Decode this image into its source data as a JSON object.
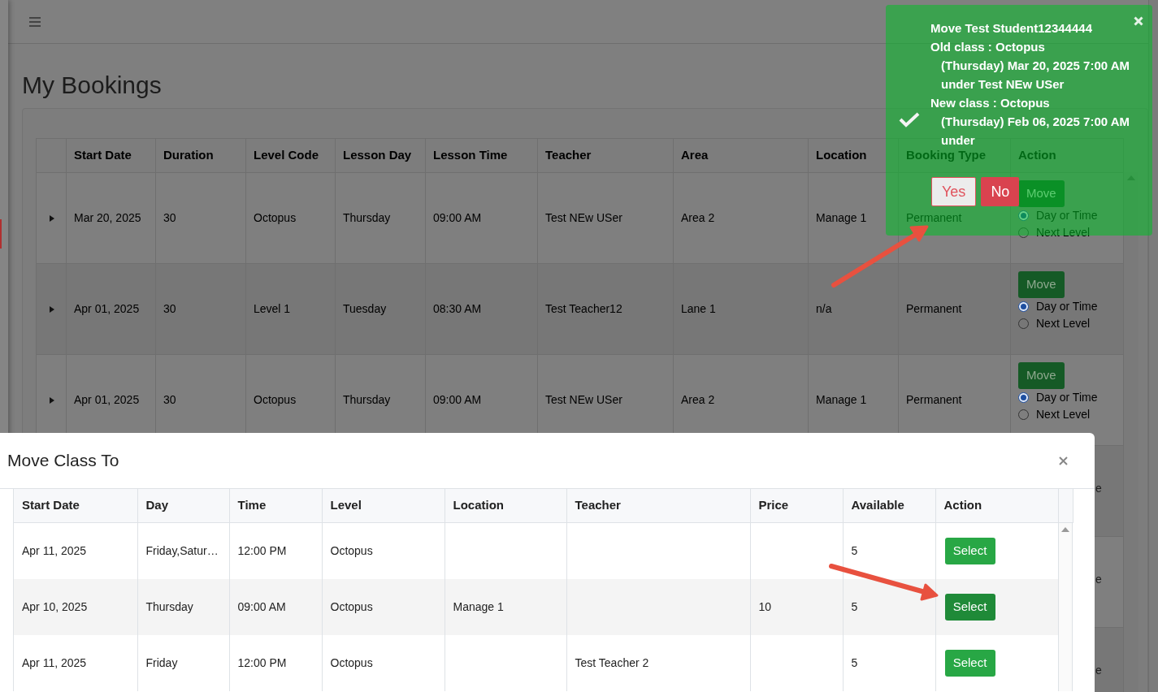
{
  "page_title": "My Bookings",
  "bookings": {
    "columns": [
      "Start Date",
      "Duration",
      "Level Code",
      "Lesson Day",
      "Lesson Time",
      "Teacher",
      "Area",
      "Location",
      "Booking Type",
      "Action"
    ],
    "rows": [
      {
        "cells": [
          "Mar 20, 2025",
          "30",
          "Octopus",
          "Thursday",
          "09:00 AM",
          "Test NEw USer",
          "Area 2",
          "Manage 1",
          "Permanent"
        ],
        "button": "Move",
        "options": [
          {
            "label": "Day or Time",
            "selected": true
          },
          {
            "label": "Next Level",
            "selected": false
          }
        ]
      },
      {
        "cells": [
          "Apr 01, 2025",
          "30",
          "Level 1",
          "Tuesday",
          "08:30 AM",
          "Test Teacher12",
          "Lane 1",
          "n/a",
          "Permanent"
        ],
        "button": "Move",
        "options": [
          {
            "label": "Day or Time",
            "selected": true
          },
          {
            "label": "Next Level",
            "selected": false
          }
        ]
      },
      {
        "cells": [
          "Apr 01, 2025",
          "30",
          "Octopus",
          "Thursday",
          "09:00 AM",
          "Test NEw USer",
          "Area 2",
          "Manage 1",
          "Permanent"
        ],
        "button": "Move",
        "options": [
          {
            "label": "Day or Time",
            "selected": true
          },
          {
            "label": "Next Level",
            "selected": false
          }
        ]
      }
    ],
    "covered_rows": [
      {
        "fragment": "e"
      },
      {
        "fragment": "e"
      },
      {
        "fragment": "e"
      }
    ]
  },
  "toast": {
    "lines": [
      {
        "kind": "heading",
        "text": "Move Test Student12344444"
      },
      {
        "kind": "heading",
        "text": "Old class : Octopus"
      },
      {
        "kind": "detail",
        "text": "(Thursday) Mar 20, 2025 7:00 AM"
      },
      {
        "kind": "detail",
        "text": "under Test NEw USer"
      },
      {
        "kind": "heading",
        "text": "New class : Octopus"
      },
      {
        "kind": "detail",
        "text": "(Thursday) Feb 06, 2025 7:00 AM"
      },
      {
        "kind": "detail",
        "text": "under"
      }
    ],
    "buttons": [
      {
        "kind": "confirm",
        "label": "Yes"
      },
      {
        "kind": "cancel",
        "label": "No"
      }
    ]
  },
  "modal": {
    "title": "Move Class To",
    "columns": [
      "Start Date",
      "Day",
      "Time",
      "Level",
      "Location",
      "Teacher",
      "Price",
      "Available",
      "Action"
    ],
    "rows": [
      {
        "cells": [
          "Apr 11, 2025",
          "Friday,Satur…",
          "12:00 PM",
          "Octopus",
          "",
          "",
          "",
          "5"
        ],
        "button": "Select",
        "highlighted": false
      },
      {
        "cells": [
          "Apr 10, 2025",
          "Thursday",
          "09:00 AM",
          "Octopus",
          "Manage 1",
          "",
          "10",
          "5"
        ],
        "button": "Select",
        "highlighted": true
      },
      {
        "cells": [
          "Apr 11, 2025",
          "Friday",
          "12:00 PM",
          "Octopus",
          "",
          "Test Teacher 2",
          "",
          "5"
        ],
        "button": "Select",
        "highlighted": false
      }
    ]
  }
}
